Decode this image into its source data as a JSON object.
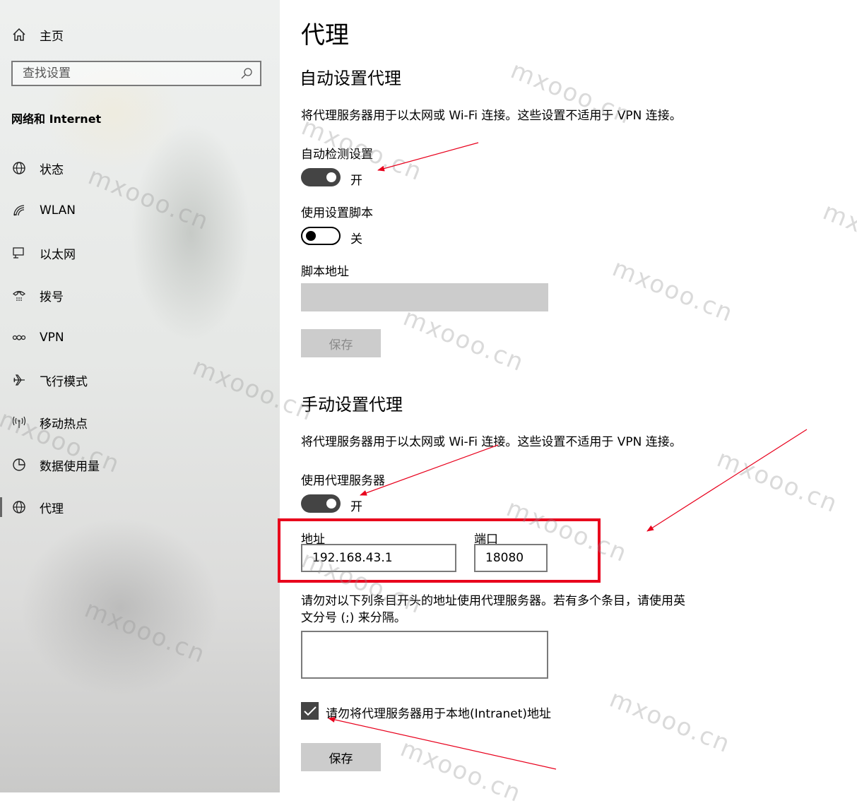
{
  "sidebar": {
    "home_label": "主页",
    "search_placeholder": "查找设置",
    "section_title": "网络和 Internet",
    "items": [
      {
        "label": "状态",
        "icon": "status-globe-icon"
      },
      {
        "label": "WLAN",
        "icon": "wifi-icon"
      },
      {
        "label": "以太网",
        "icon": "ethernet-icon"
      },
      {
        "label": "拨号",
        "icon": "dialup-icon"
      },
      {
        "label": "VPN",
        "icon": "vpn-icon"
      },
      {
        "label": "飞行模式",
        "icon": "airplane-icon"
      },
      {
        "label": "移动热点",
        "icon": "hotspot-icon"
      },
      {
        "label": "数据使用量",
        "icon": "data-usage-icon"
      },
      {
        "label": "代理",
        "icon": "globe-icon",
        "active": true
      }
    ]
  },
  "main": {
    "title": "代理",
    "auto": {
      "heading": "自动设置代理",
      "description": "将代理服务器用于以太网或 Wi-Fi 连接。这些设置不适用于 VPN 连接。",
      "detect_label": "自动检测设置",
      "detect_state": "开",
      "script_label": "使用设置脚本",
      "script_state": "关",
      "script_address_label": "脚本地址",
      "save_label": "保存"
    },
    "manual": {
      "heading": "手动设置代理",
      "description": "将代理服务器用于以太网或 Wi-Fi 连接。这些设置不适用于 VPN 连接。",
      "use_proxy_label": "使用代理服务器",
      "use_proxy_state": "开",
      "address_label": "地址",
      "address_value": "192.168.43.1",
      "port_label": "端口",
      "port_value": "18080",
      "exceptions_line1": "请勿对以下列条目开头的地址使用代理服务器。若有多个条目，请使用英",
      "exceptions_line2": "文分号 (;) 来分隔。",
      "exceptions_value": "",
      "bypass_local_label": "请勿将代理服务器用于本地(Intranet)地址",
      "bypass_local_checked": true,
      "save_label": "保存"
    }
  },
  "watermark": "mxooo.cn",
  "colors": {
    "annotation_red": "#e8001c",
    "toggle_on": "#444444",
    "button_gray": "#cccccc"
  }
}
